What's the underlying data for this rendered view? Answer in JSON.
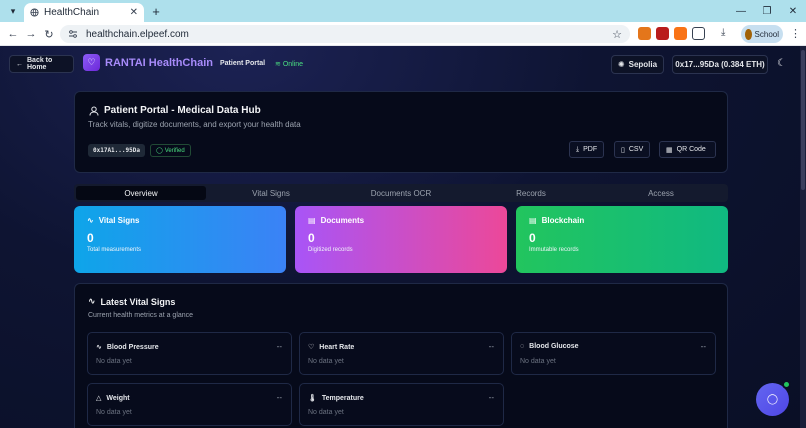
{
  "browser": {
    "tab_title": "HealthChain",
    "url": "healthchain.elpeef.com",
    "profile_name": "School"
  },
  "app": {
    "back_label": "Back to Home",
    "brand_name": "RANTAI HealthChain",
    "portal_label": "Patient Portal",
    "status_label": "Online",
    "network_label": "Sepolia",
    "wallet_label": "0x17...95Da (0.384 ETH)"
  },
  "hero": {
    "title": "Patient Portal - Medical Data Hub",
    "subtitle": "Track vitals, digitize documents, and export your health data",
    "address": "0x17A1...95Da",
    "verified_label": "Verified",
    "export_pdf": "PDF",
    "export_csv": "CSV",
    "export_qr": "QR Code"
  },
  "tabs": [
    "Overview",
    "Vital Signs",
    "Documents OCR",
    "Records",
    "Access"
  ],
  "stats": [
    {
      "title": "Vital Signs",
      "value": "0",
      "caption": "Total measurements"
    },
    {
      "title": "Documents",
      "value": "0",
      "caption": "Digitized records"
    },
    {
      "title": "Blockchain",
      "value": "0",
      "caption": "Immutable records"
    }
  ],
  "vitals": {
    "title": "Latest Vital Signs",
    "subtitle": "Current health metrics at a glance",
    "items": [
      {
        "name": "Blood Pressure",
        "value": "--",
        "status": "No data yet"
      },
      {
        "name": "Heart Rate",
        "value": "--",
        "status": "No data yet"
      },
      {
        "name": "Blood Glucose",
        "value": "--",
        "status": "No data yet"
      },
      {
        "name": "Weight",
        "value": "--",
        "status": "No data yet"
      },
      {
        "name": "Temperature",
        "value": "--",
        "status": "No data yet"
      }
    ]
  },
  "colors": {
    "accent_purple": "#8b5cf6",
    "online_green": "#4ade80",
    "card_blue": "#3b82f6",
    "card_pink": "#ec4899",
    "card_green": "#22c55e"
  }
}
